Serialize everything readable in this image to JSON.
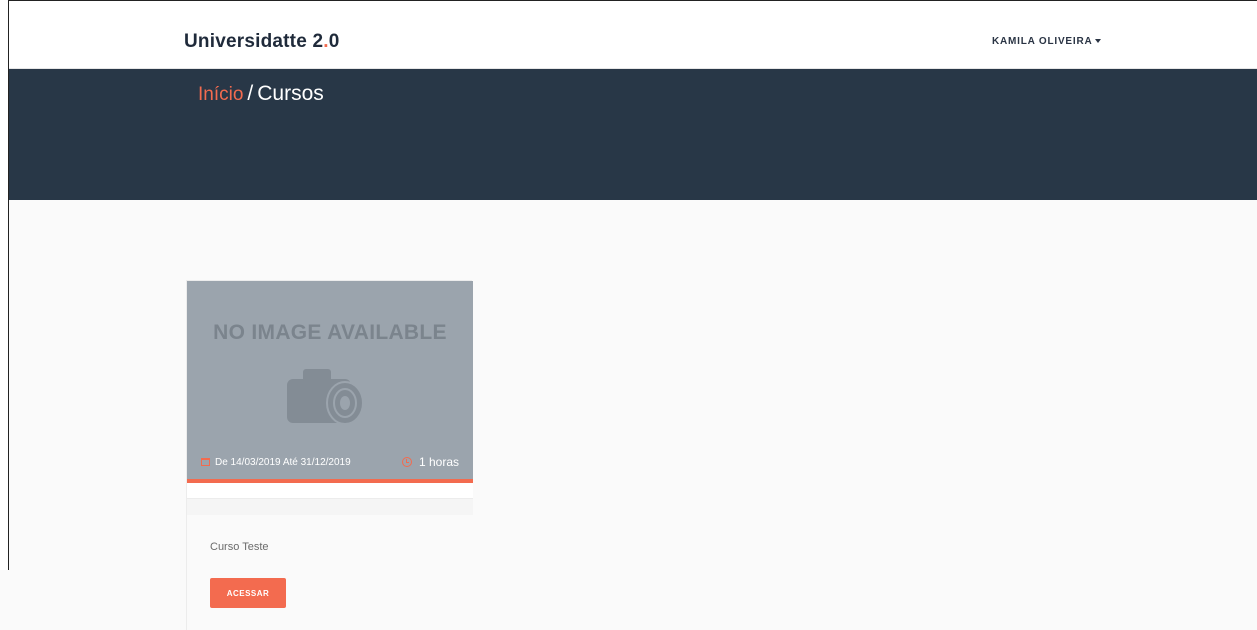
{
  "app": {
    "brand_prefix": "Universidatte 2",
    "brand_dot": ".",
    "brand_suffix": "0"
  },
  "navbar": {
    "user_name": "KAMILA OLIVEIRA"
  },
  "breadcrumb": {
    "home": "Início",
    "separator": "/",
    "current": "Cursos"
  },
  "courses": [
    {
      "image_placeholder_text": "NO IMAGE AVAILABLE",
      "date_range": "De 14/03/2019 Até 31/12/2019",
      "duration": "1 horas",
      "title": "Curso Teste",
      "action_label": "ACESSAR"
    }
  ],
  "colors": {
    "accent": "#f36b4f",
    "hero_bg": "#283747",
    "image_placeholder_bg": "#9ba4ad"
  },
  "icons": [
    "caret-down-icon",
    "calendar-icon",
    "clock-icon",
    "camera-icon"
  ]
}
